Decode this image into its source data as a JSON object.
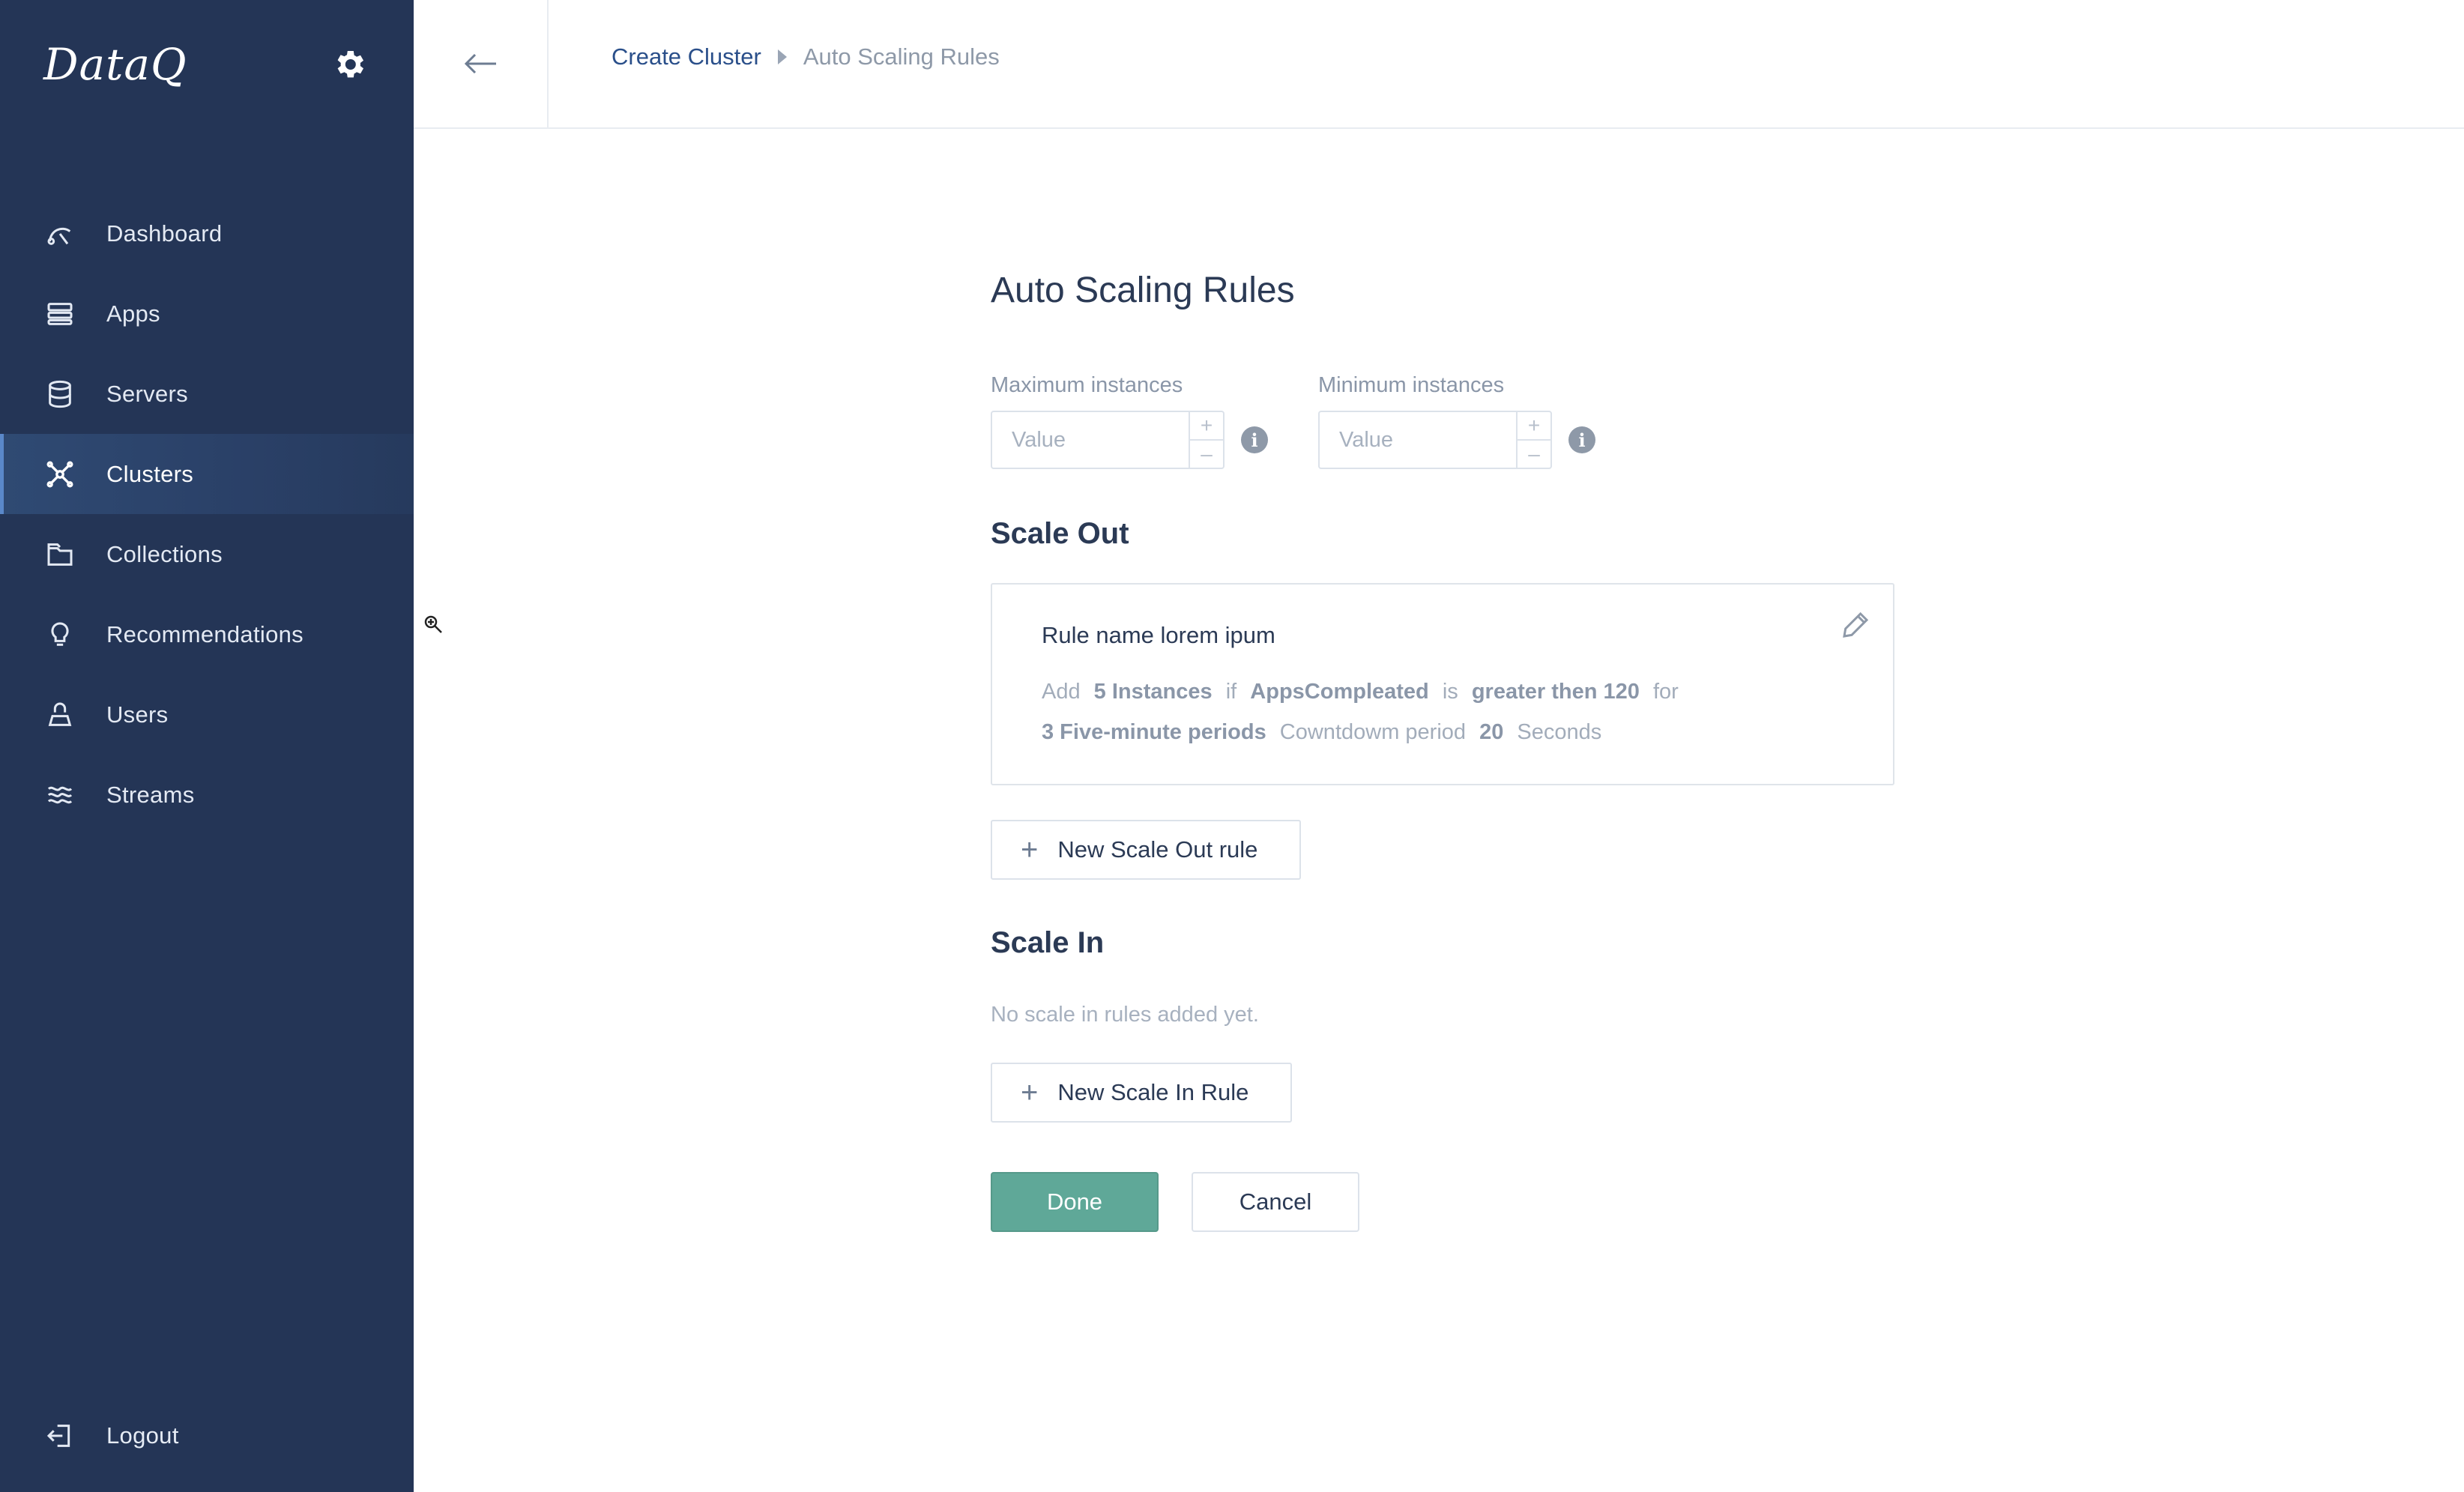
{
  "app": {
    "logo": "DataQ"
  },
  "sidebar": {
    "items": [
      {
        "label": "Dashboard",
        "icon": "dashboard-icon",
        "active": false
      },
      {
        "label": "Apps",
        "icon": "apps-icon",
        "active": false
      },
      {
        "label": "Servers",
        "icon": "servers-icon",
        "active": false
      },
      {
        "label": "Clusters",
        "icon": "clusters-icon",
        "active": true
      },
      {
        "label": "Collections",
        "icon": "collections-icon",
        "active": false
      },
      {
        "label": "Recommendations",
        "icon": "recommendations-icon",
        "active": false
      },
      {
        "label": "Users",
        "icon": "users-icon",
        "active": false
      },
      {
        "label": "Streams",
        "icon": "streams-icon",
        "active": false
      }
    ],
    "logout_label": "Logout"
  },
  "breadcrumb": {
    "parent": "Create Cluster",
    "current": "Auto Scaling Rules"
  },
  "page": {
    "title": "Auto Scaling Rules",
    "max_instances": {
      "label": "Maximum instances",
      "placeholder": "Value",
      "value": ""
    },
    "min_instances": {
      "label": "Minimum instances",
      "placeholder": "Value",
      "value": ""
    },
    "scale_out": {
      "title": "Scale Out",
      "rule": {
        "name": "Rule name lorem ipum",
        "w_add": "Add",
        "instances": "5 Instances",
        "w_if": "if",
        "metric": "AppsCompleated",
        "w_is": "is",
        "condition": "greater then 120",
        "w_for": "for",
        "periods": "3 Five-minute periods",
        "cooldown_label": "Cowntdowm period",
        "cooldown_value": "20",
        "cooldown_unit": "Seconds"
      },
      "new_button": "New Scale Out rule"
    },
    "scale_in": {
      "title": "Scale In",
      "empty": "No scale in rules added yet.",
      "new_button": "New Scale In Rule"
    },
    "done_button": "Done",
    "cancel_button": "Cancel"
  },
  "colors": {
    "sidebar": "#243556",
    "accent": "#5fa898",
    "link": "#2a4f8a"
  }
}
